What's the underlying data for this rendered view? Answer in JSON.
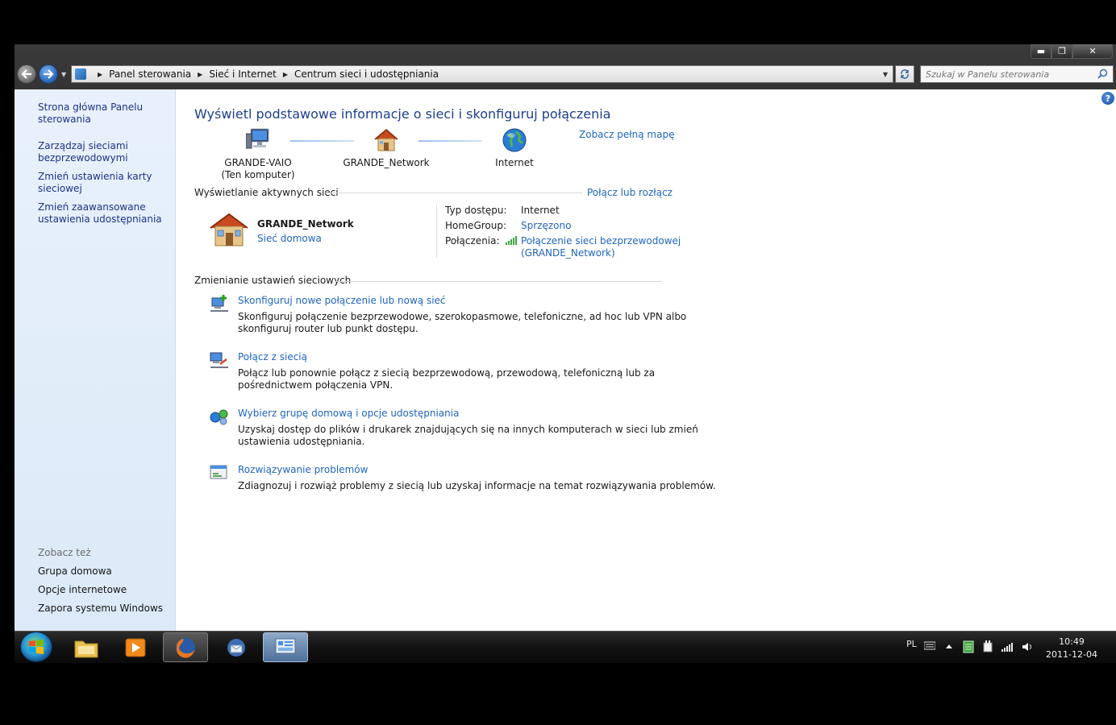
{
  "titlebar": {
    "minimize_glyph": "▬",
    "maximize_glyph": "❐",
    "close_glyph": "✕"
  },
  "address": {
    "breadcrumbs": [
      "Panel sterowania",
      "Sieć i Internet",
      "Centrum sieci i udostępniania"
    ],
    "search_placeholder": "Szukaj w Panelu sterowania"
  },
  "sidebar": {
    "links": [
      "Strona główna Panelu sterowania",
      "Zarządzaj sieciami bezprzewodowymi",
      "Zmień ustawienia karty sieciowej",
      "Zmień zaawansowane ustawienia udostępniania"
    ],
    "see_also_header": "Zobacz też",
    "see_also": [
      "Grupa domowa",
      "Opcje internetowe",
      "Zapora systemu Windows"
    ]
  },
  "main": {
    "title": "Wyświetl podstawowe informacje o sieci i skonfiguruj połączenia",
    "full_map_link": "Zobacz pełną mapę",
    "map": {
      "computer_name": "GRANDE-VAIO",
      "computer_sub": "(Ten komputer)",
      "network_name": "GRANDE_Network",
      "internet_label": "Internet"
    },
    "active_section": {
      "header": "Wyświetlanie aktywnych sieci",
      "connect_link": "Połącz lub rozłącz",
      "network_name": "GRANDE_Network",
      "network_type": "Sieć domowa",
      "access_type_label": "Typ dostępu:",
      "access_type_value": "Internet",
      "homegroup_label": "HomeGroup:",
      "homegroup_value": "Sprzęzono",
      "connections_label": "Połączenia:",
      "connection_value_line1": "Połączenie sieci bezprzewodowej",
      "connection_value_line2": "(GRANDE_Network)"
    },
    "change_section": {
      "header": "Zmienianie ustawień sieciowych",
      "tasks": [
        {
          "title": "Skonfiguruj nowe połączenie lub nową sieć",
          "desc1": "Skonfiguruj połączenie bezprzewodowe, szerokopasmowe, telefoniczne, ad hoc lub VPN albo",
          "desc2": "skonfiguruj router lub punkt dostępu."
        },
        {
          "title": "Połącz z siecią",
          "desc1": "Połącz lub ponownie połącz z siecią bezprzewodową, przewodową, telefoniczną lub za",
          "desc2": "pośrednictwem połączenia VPN."
        },
        {
          "title": "Wybierz grupę domową i opcje udostępniania",
          "desc1": "Uzyskaj dostęp do plików i drukarek znajdujących się na innych komputerach w sieci lub zmień",
          "desc2": "ustawienia udostępniania."
        },
        {
          "title": "Rozwiązywanie problemów",
          "desc1": "Zdiagnozuj i rozwiąż problemy z siecią lub uzyskaj informacje na temat rozwiązywania problemów.",
          "desc2": ""
        }
      ]
    }
  },
  "taskbar": {
    "language": "PL",
    "time": "10:49",
    "date": "2011-12-04",
    "pinned": [
      "windows-explorer",
      "media-player",
      "firefox",
      "thunderbird",
      "control-panel"
    ]
  },
  "colors": {
    "link": "#1f66c0",
    "title": "#1e3f8f",
    "sidebar_bg": "#dce9f8"
  }
}
